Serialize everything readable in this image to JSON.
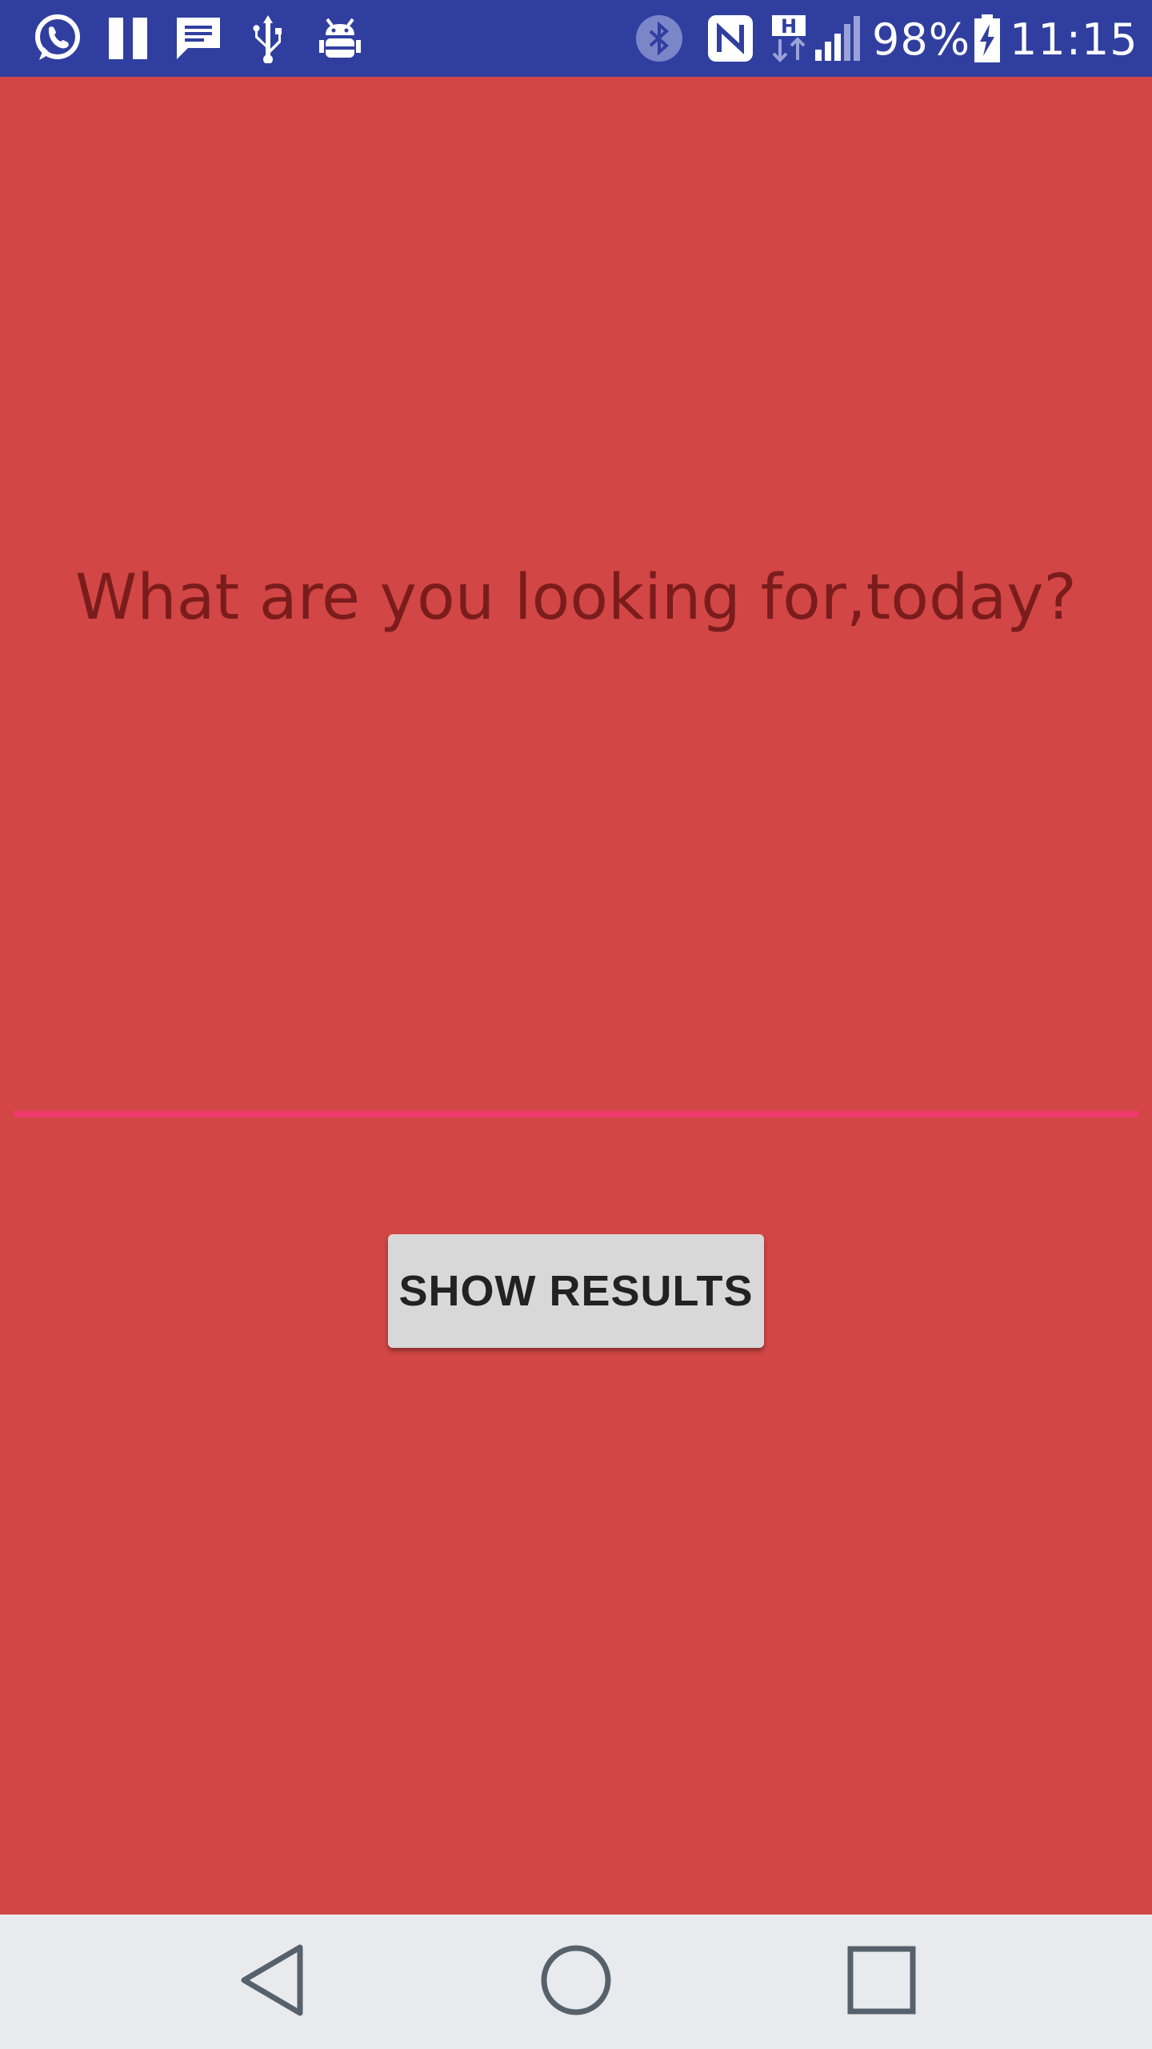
{
  "status_bar": {
    "background": "#303f9f",
    "left_icons": [
      "whatsapp-icon",
      "pause-icon",
      "message-icon",
      "usb-icon",
      "android-debug-icon"
    ],
    "right_icons": [
      "bluetooth-icon",
      "nfc-icon",
      "hspa-data-icon",
      "signal-icon",
      "battery-charging-icon"
    ],
    "battery_percent": "98%",
    "time": "11:15"
  },
  "main": {
    "background": "#d24645",
    "prompt": "What are you looking for,today?",
    "search": {
      "value": "",
      "placeholder": "",
      "underline_color": "#f0386b"
    },
    "show_results_label": "SHOW RESULTS"
  },
  "nav_bar": {
    "background": "#e9eaed",
    "buttons": [
      "back-icon",
      "home-icon",
      "recents-icon"
    ]
  }
}
